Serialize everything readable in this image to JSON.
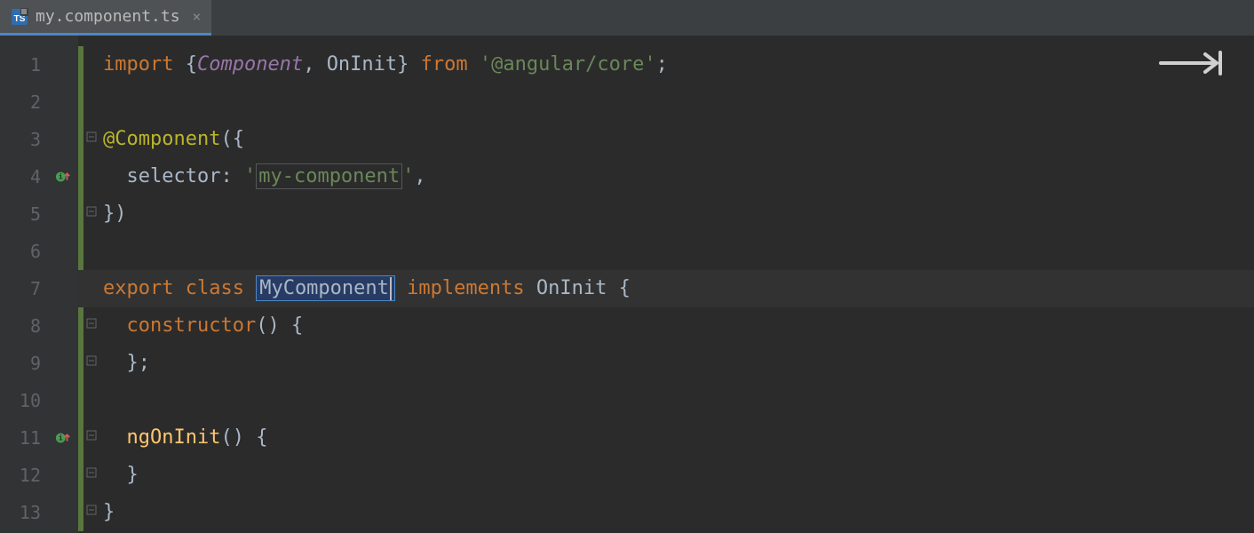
{
  "tab": {
    "filename": "my.component.ts",
    "close": "×"
  },
  "gutter": {
    "lines": [
      "1",
      "2",
      "3",
      "4",
      "5",
      "6",
      "7",
      "8",
      "9",
      "10",
      "11",
      "12",
      "13"
    ]
  },
  "code": {
    "l1": {
      "import": "import ",
      "lb": "{",
      "component": "Component",
      "comma": ", ",
      "oninit": "OnInit",
      "rb": "}",
      "from": " from ",
      "q1": "'",
      "str": "@angular/core",
      "q2": "'",
      "semi": ";"
    },
    "l3": {
      "deco": "@Component",
      "open": "({"
    },
    "l4": {
      "indent": "  ",
      "sel": "selector",
      "colon": ": ",
      "q1": "'",
      "val": "my-component",
      "q2": "'",
      "comma": ","
    },
    "l5": {
      "close": "})"
    },
    "l7": {
      "export": "export ",
      "class": "class ",
      "name": "MyComponent",
      "impl": " implements ",
      "oninit": "OnInit ",
      "brace": "{"
    },
    "l8": {
      "indent": "  ",
      "ctor": "constructor",
      "paren": "() {"
    },
    "l9": {
      "indent": "  ",
      "close": "};"
    },
    "l11": {
      "indent": "  ",
      "fn": "ngOnInit",
      "paren": "() {"
    },
    "l12": {
      "indent": "  ",
      "close": "}"
    },
    "l13": {
      "close": "}"
    }
  }
}
